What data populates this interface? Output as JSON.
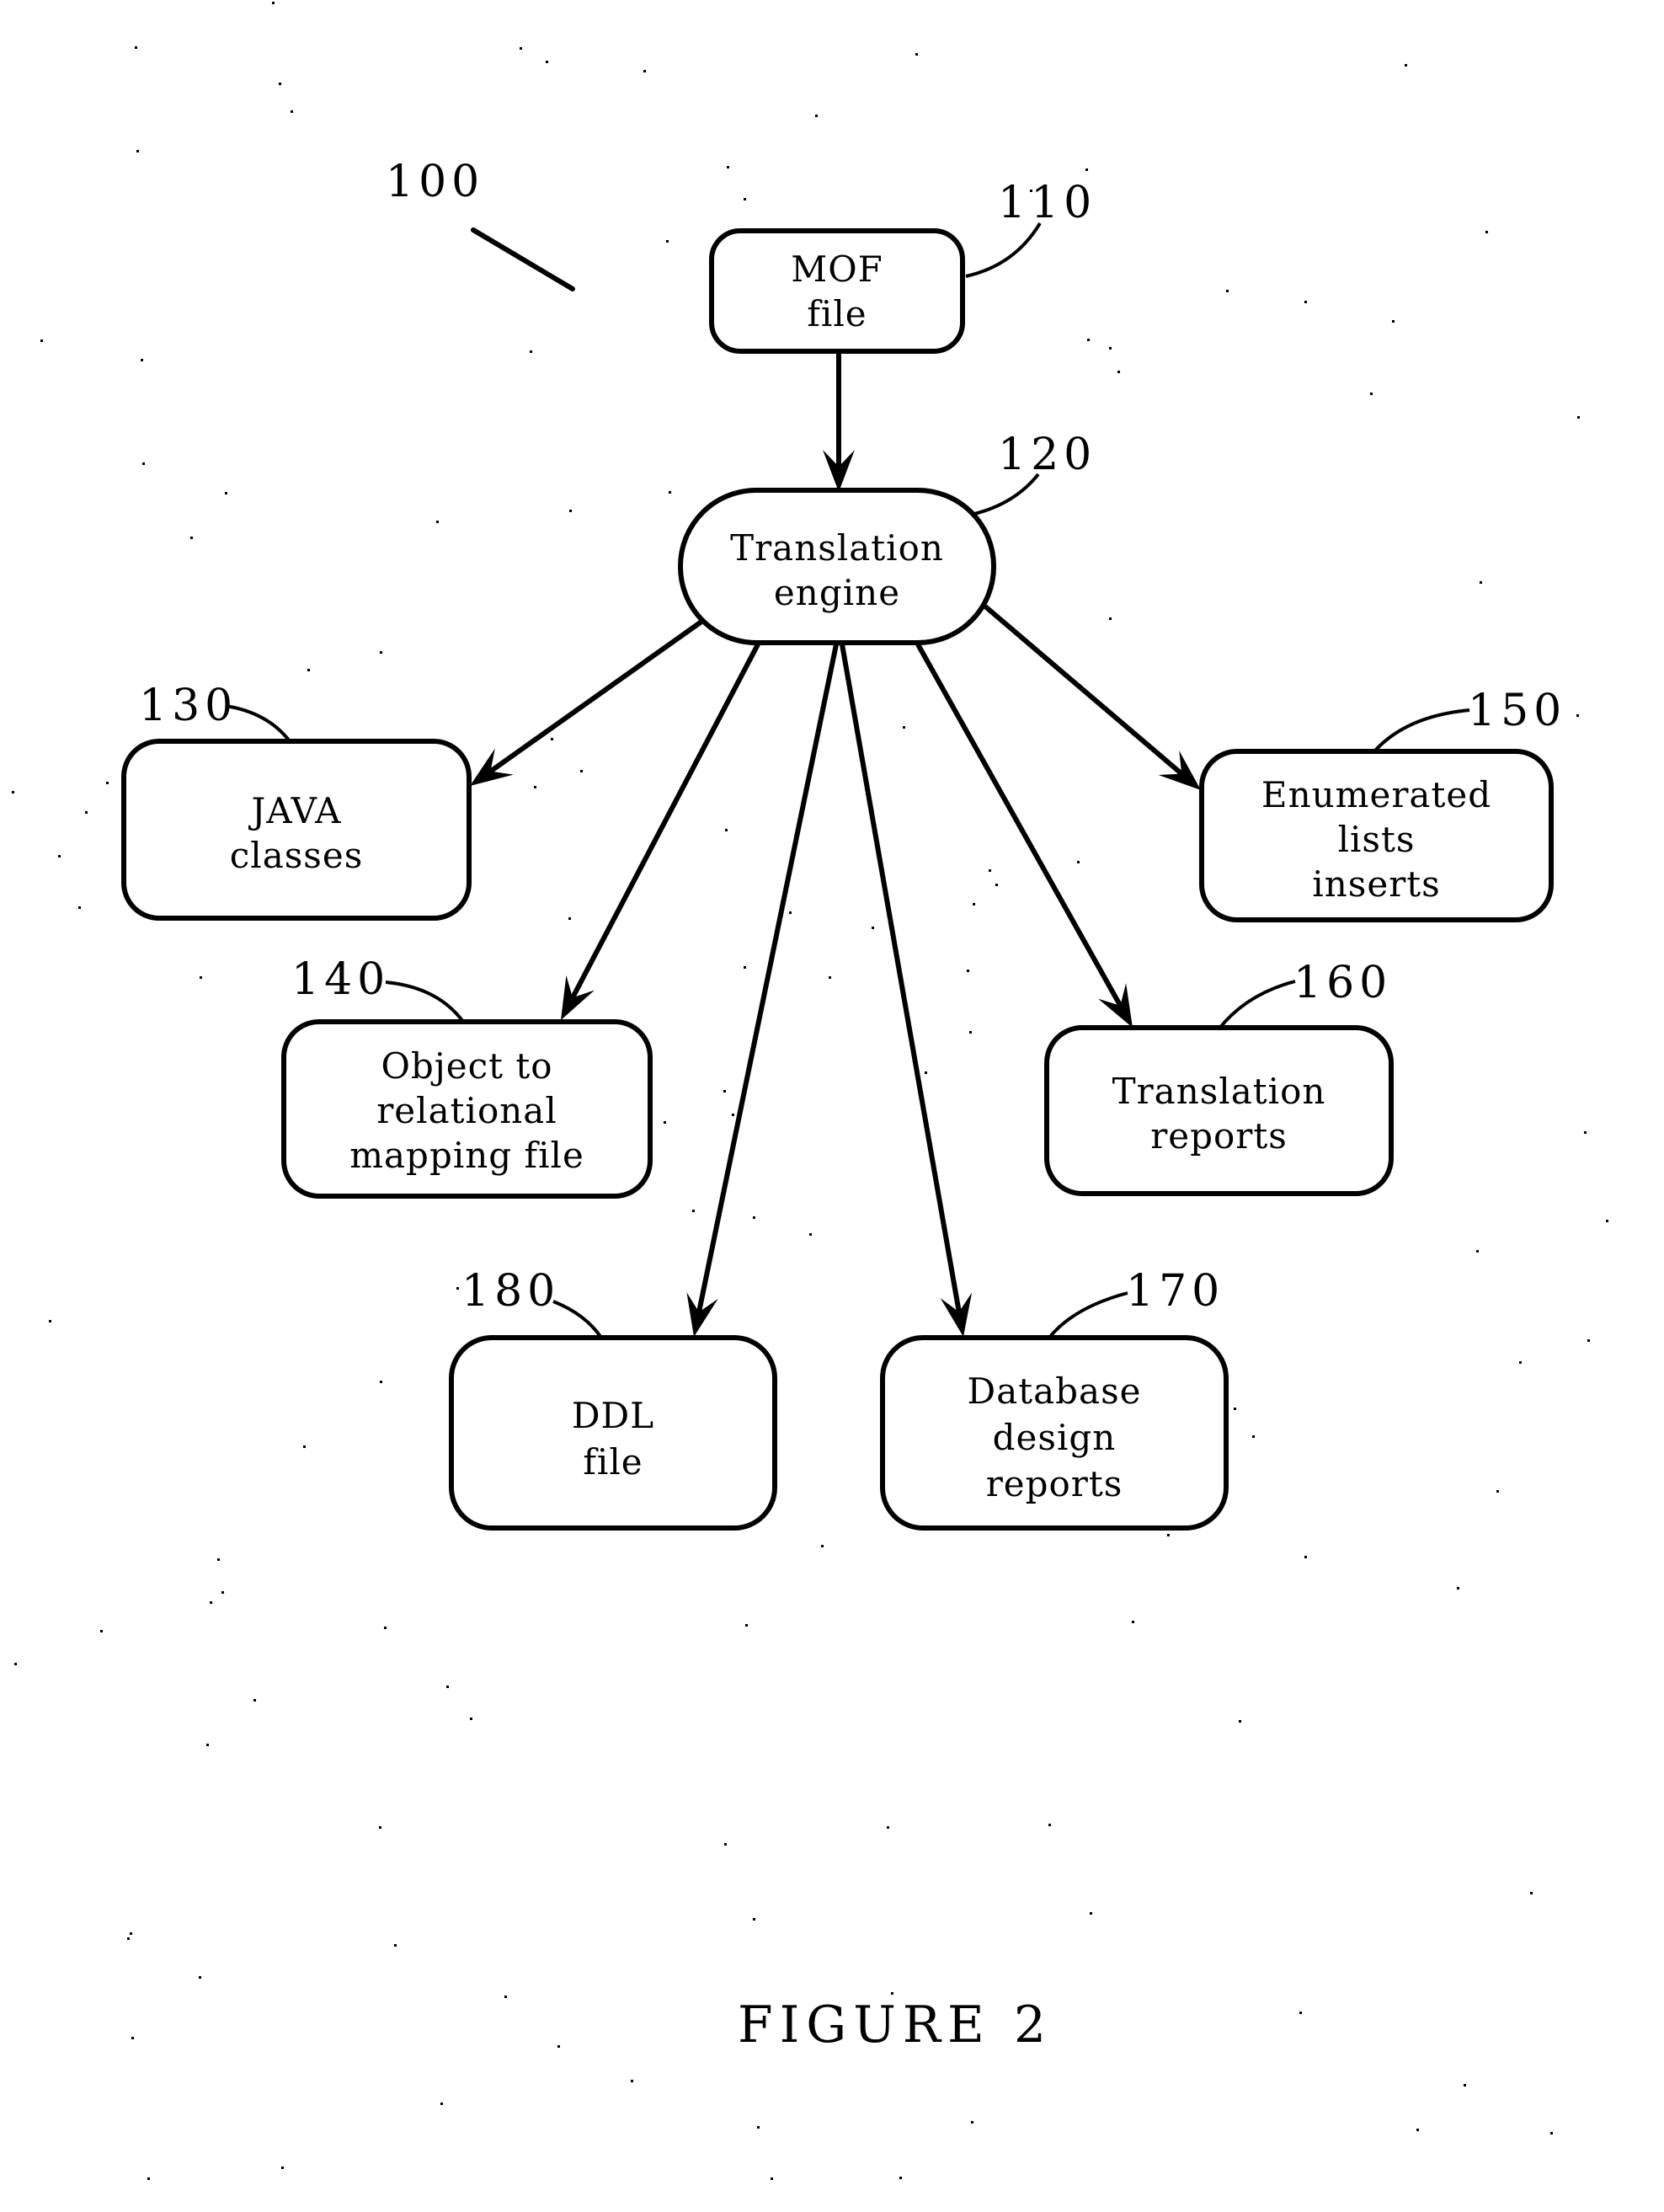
{
  "figure": {
    "caption": "FIGURE 2",
    "system_ref": "100"
  },
  "nodes": [
    {
      "id": "mof",
      "ref": "110",
      "lines": [
        "MOF",
        "file"
      ],
      "shape": "rounded-rect"
    },
    {
      "id": "engine",
      "ref": "120",
      "lines": [
        "Translation",
        "engine"
      ],
      "shape": "stadium"
    },
    {
      "id": "java",
      "ref": "130",
      "lines": [
        "JAVA",
        "classes"
      ],
      "shape": "rounded-rect"
    },
    {
      "id": "orm",
      "ref": "140",
      "lines": [
        "Object to",
        "relational",
        "mapping file"
      ],
      "shape": "rounded-rect"
    },
    {
      "id": "enum",
      "ref": "150",
      "lines": [
        "Enumerated",
        "lists",
        "inserts"
      ],
      "shape": "rounded-rect"
    },
    {
      "id": "treports",
      "ref": "160",
      "lines": [
        "Translation",
        "reports"
      ],
      "shape": "rounded-rect"
    },
    {
      "id": "dbreports",
      "ref": "170",
      "lines": [
        "Database",
        "design",
        "reports"
      ],
      "shape": "rounded-rect"
    },
    {
      "id": "ddl",
      "ref": "180",
      "lines": [
        "DDL",
        "file"
      ],
      "shape": "rounded-rect"
    }
  ],
  "edges": [
    {
      "from": "mof",
      "to": "engine"
    },
    {
      "from": "engine",
      "to": "java"
    },
    {
      "from": "engine",
      "to": "orm"
    },
    {
      "from": "engine",
      "to": "ddl"
    },
    {
      "from": "engine",
      "to": "dbreports"
    },
    {
      "from": "engine",
      "to": "treports"
    },
    {
      "from": "engine",
      "to": "enum"
    }
  ]
}
